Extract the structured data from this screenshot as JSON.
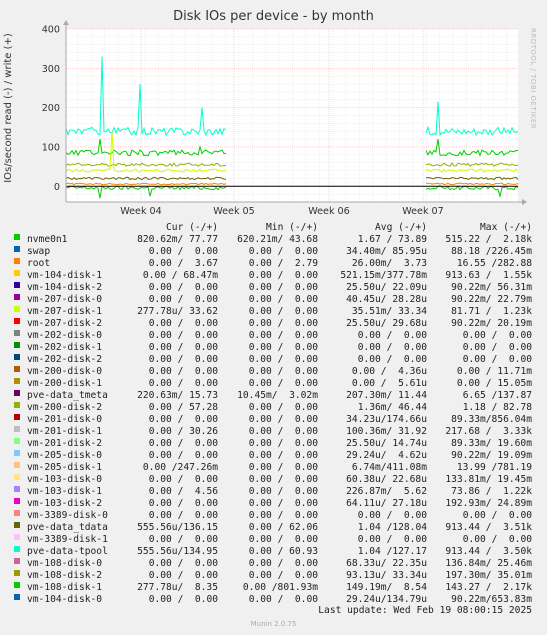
{
  "title": "Disk IOs per device - by month",
  "side_credit": "RRDTOOL / TOBI OETIKER",
  "footer": "Last update: Wed Feb 19 08:00:15 2025",
  "munin": "Munin 2.0.75",
  "chart_data": {
    "type": "line",
    "title": "Disk IOs per device - by month",
    "ylabel": "IOs/second read (-) / write (+)",
    "ylim": [
      -40,
      400
    ],
    "yticks": [
      0,
      100,
      200,
      300,
      400
    ],
    "xticks": [
      "Week 04",
      "Week 05",
      "Week 06",
      "Week 07"
    ],
    "grid": true,
    "columns": [
      "Cur (-/+)",
      "Min (-/+)",
      "Avg (-/+)",
      "Max (-/+)"
    ],
    "series": [
      {
        "name": "nvme0n1",
        "color": "#00cc00",
        "cur": "820.62m/ 77.77",
        "min": "620.21m/ 43.68",
        "avg": "1.67 / 73.89",
        "max": "515.22 /  2.18k"
      },
      {
        "name": "swap",
        "color": "#0066b3",
        "cur": "0.00 /  0.00",
        "min": "0.00 /  0.00",
        "avg": "34.40m/ 85.95u",
        "max": "88.18 /226.45m"
      },
      {
        "name": "root",
        "color": "#ff8000",
        "cur": "0.00 /  3.67",
        "min": "0.00 /  2.79",
        "avg": "26.00m/  3.73",
        "max": "16.55 /282.88"
      },
      {
        "name": "vm-104-disk-1",
        "color": "#ffcc00",
        "cur": "0.00 / 68.47m",
        "min": "0.00 /  0.00",
        "avg": "521.15m/377.78m",
        "max": "913.63 /  1.55k"
      },
      {
        "name": "vm-104-disk-2",
        "color": "#330099",
        "cur": "0.00 /  0.00",
        "min": "0.00 /  0.00",
        "avg": "25.50u/ 22.09u",
        "max": "90.22m/ 56.31m"
      },
      {
        "name": "vm-207-disk-0",
        "color": "#990099",
        "cur": "0.00 /  0.00",
        "min": "0.00 /  0.00",
        "avg": "40.45u/ 28.28u",
        "max": "90.22m/ 22.79m"
      },
      {
        "name": "vm-207-disk-1",
        "color": "#ccff00",
        "cur": "277.78u/ 33.62",
        "min": "0.00 /  0.00",
        "avg": "35.51m/ 33.34",
        "max": "81.71 /  1.23k"
      },
      {
        "name": "vm-207-disk-2",
        "color": "#ff0000",
        "cur": "0.00 /  0.00",
        "min": "0.00 /  0.00",
        "avg": "25.50u/ 29.68u",
        "max": "90.22m/ 20.19m"
      },
      {
        "name": "vm-202-disk-0",
        "color": "#808080",
        "cur": "0.00 /  0.00",
        "min": "0.00 /  0.00",
        "avg": "0.00 /  0.00",
        "max": "0.00 /  0.00"
      },
      {
        "name": "vm-202-disk-1",
        "color": "#008f00",
        "cur": "0.00 /  0.00",
        "min": "0.00 /  0.00",
        "avg": "0.00 /  0.00",
        "max": "0.00 /  0.00"
      },
      {
        "name": "vm-202-disk-2",
        "color": "#00487d",
        "cur": "0.00 /  0.00",
        "min": "0.00 /  0.00",
        "avg": "0.00 /  0.00",
        "max": "0.00 /  0.00"
      },
      {
        "name": "vm-200-disk-0",
        "color": "#b35a00",
        "cur": "0.00 /  0.00",
        "min": "0.00 /  0.00",
        "avg": "0.00 /  4.36u",
        "max": "0.00 / 11.71m"
      },
      {
        "name": "vm-200-disk-1",
        "color": "#b38f00",
        "cur": "0.00 /  0.00",
        "min": "0.00 /  0.00",
        "avg": "0.00 /  5.61u",
        "max": "0.00 / 15.05m"
      },
      {
        "name": "pve-data_tmeta",
        "color": "#6b006b",
        "cur": "220.63m/ 15.73",
        "min": "10.45m/  3.02m",
        "avg": "207.30m/ 11.44",
        "max": "6.65 /137.87"
      },
      {
        "name": "vm-200-disk-2",
        "color": "#8fb300",
        "cur": "0.00 / 57.28",
        "min": "0.00 /  0.00",
        "avg": "1.36m/ 46.44",
        "max": "1.18 / 82.78"
      },
      {
        "name": "vm-201-disk-0",
        "color": "#b30000",
        "cur": "0.00 /  0.00",
        "min": "0.00 /  0.00",
        "avg": "34.23u/174.66u",
        "max": "89.33m/856.04m"
      },
      {
        "name": "vm-201-disk-1",
        "color": "#bebebe",
        "cur": "0.00 / 30.26",
        "min": "0.00 /  0.00",
        "avg": "100.36m/ 31.92",
        "max": "217.68 /  3.33k"
      },
      {
        "name": "vm-201-disk-2",
        "color": "#80ff80",
        "cur": "0.00 /  0.00",
        "min": "0.00 /  0.00",
        "avg": "25.50u/ 14.74u",
        "max": "89.33m/ 19.60m"
      },
      {
        "name": "vm-205-disk-0",
        "color": "#80c9ff",
        "cur": "0.00 /  0.00",
        "min": "0.00 /  0.00",
        "avg": "29.24u/  4.62u",
        "max": "90.22m/ 19.09m"
      },
      {
        "name": "vm-205-disk-1",
        "color": "#ffc080",
        "cur": "0.00 /247.26m",
        "min": "0.00 /  0.00",
        "avg": "6.74m/411.08m",
        "max": "13.99 /781.19"
      },
      {
        "name": "vm-103-disk-0",
        "color": "#ffe680",
        "cur": "0.00 /  0.00",
        "min": "0.00 /  0.00",
        "avg": "60.38u/ 22.68u",
        "max": "133.81m/ 19.45m"
      },
      {
        "name": "vm-103-disk-1",
        "color": "#aa80ff",
        "cur": "0.00 /  4.56",
        "min": "0.00 /  0.00",
        "avg": "226.87m/  5.62",
        "max": "73.86 /  1.22k"
      },
      {
        "name": "vm-103-disk-2",
        "color": "#ee00cc",
        "cur": "0.00 /  0.00",
        "min": "0.00 /  0.00",
        "avg": "64.11u/ 27.18u",
        "max": "192.93m/ 24.89m"
      },
      {
        "name": "vm-3389-disk-0",
        "color": "#ff8080",
        "cur": "0.00 /  0.00",
        "min": "0.00 /  0.00",
        "avg": "0.00 /  0.00",
        "max": "0.00 /  0.00"
      },
      {
        "name": "pve-data_tdata",
        "color": "#666600",
        "cur": "555.56u/136.15",
        "min": "0.00 / 62.06",
        "avg": "1.04 /128.04",
        "max": "913.44 /  3.51k"
      },
      {
        "name": "vm-3389-disk-1",
        "color": "#ffbfff",
        "cur": "0.00 /  0.00",
        "min": "0.00 /  0.00",
        "avg": "0.00 /  0.00",
        "max": "0.00 /  0.00"
      },
      {
        "name": "pve-data-tpool",
        "color": "#00ffcc",
        "cur": "555.56u/134.95",
        "min": "0.00 / 60.93",
        "avg": "1.04 /127.17",
        "max": "913.44 /  3.50k"
      },
      {
        "name": "vm-108-disk-0",
        "color": "#cc6699",
        "cur": "0.00 /  0.00",
        "min": "0.00 /  0.00",
        "avg": "68.33u/ 22.35u",
        "max": "136.84m/ 25.46m"
      },
      {
        "name": "vm-108-disk-2",
        "color": "#999900",
        "cur": "0.00 /  0.00",
        "min": "0.00 /  0.00",
        "avg": "93.13u/ 33.34u",
        "max": "197.30m/ 35.01m"
      },
      {
        "name": "vm-108-disk-1",
        "color": "#00cc00",
        "cur": "277.78u/  8.35",
        "min": "0.00 /801.93m",
        "avg": "149.19m/  8.54",
        "max": "143.27 /  2.17k"
      },
      {
        "name": "vm-104-disk-0",
        "color": "#0066b3",
        "cur": "0.00 /  0.00",
        "min": "0.00 /  0.00",
        "avg": "29.24u/134.79u",
        "max": "90.22m/653.83m"
      }
    ]
  }
}
